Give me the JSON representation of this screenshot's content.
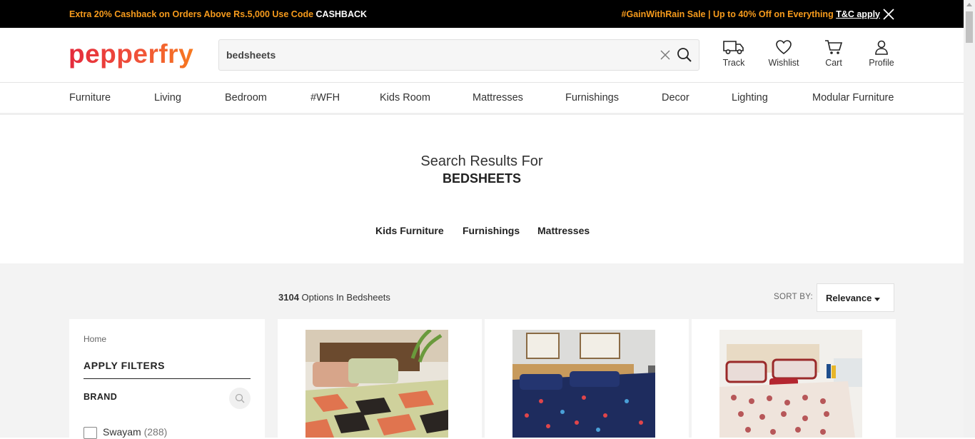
{
  "promo": {
    "left_text": "Extra 20% Cashback on Orders Above Rs.5,000 Use Code ",
    "left_code": "CASHBACK",
    "right_text": "#GainWithRain Sale | Up to 40% Off on Everything ",
    "right_link": "T&C apply",
    "close_icon": "close-icon"
  },
  "header": {
    "logo": "pepperfry",
    "search_value": "bedsheets",
    "icons": [
      {
        "label": "Track",
        "icon": "truck-icon"
      },
      {
        "label": "Wishlist",
        "icon": "heart-icon"
      },
      {
        "label": "Cart",
        "icon": "cart-icon"
      },
      {
        "label": "Profile",
        "icon": "user-icon"
      }
    ]
  },
  "nav": [
    "Furniture",
    "Living",
    "Bedroom",
    "#WFH",
    "Kids Room",
    "Mattresses",
    "Furnishings",
    "Decor",
    "Lighting",
    "Modular Furniture"
  ],
  "results": {
    "heading": "Search Results For",
    "query": "BEDSHEETS",
    "categories": [
      "Kids Furniture",
      "Furnishings",
      "Mattresses"
    ]
  },
  "listing": {
    "count": "3104",
    "count_suffix": " Options In Bedsheets",
    "sort_label": "SORT BY:",
    "sort_value": "Relevance"
  },
  "filters": {
    "breadcrumb": "Home",
    "title": "APPLY FILTERS",
    "section": "BRAND",
    "options": [
      {
        "label": "Swayam",
        "count": "(288)"
      }
    ]
  },
  "colors": {
    "brand_orange": "#f79b1c",
    "brand_red": "#e42a3c",
    "promo_bg": "#000000",
    "page_gray": "#f3f3f3"
  }
}
